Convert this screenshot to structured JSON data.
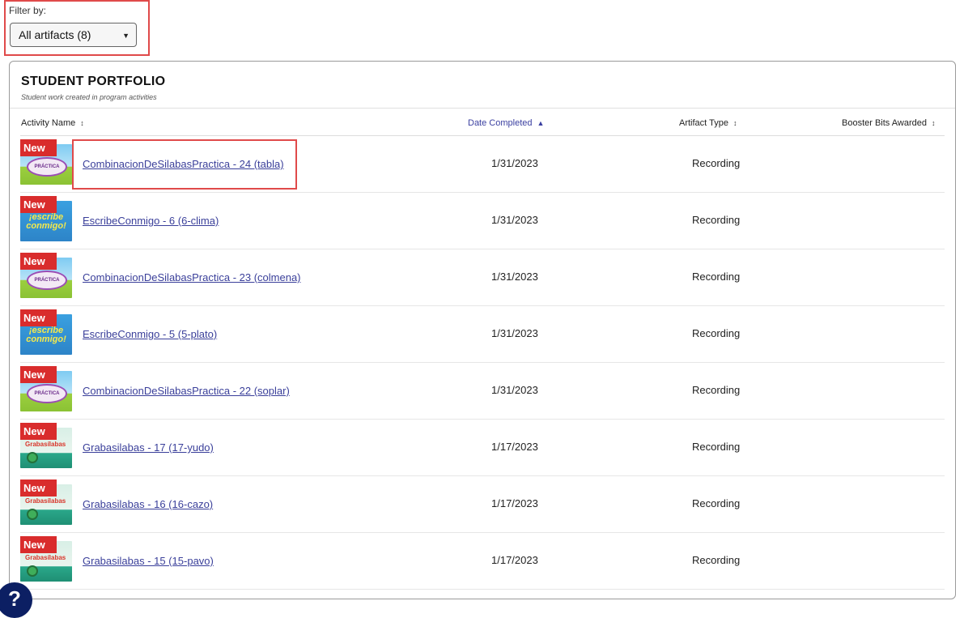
{
  "filter": {
    "label": "Filter by:",
    "selected": "All artifacts (8)",
    "caret_icon": "caret-down-icon"
  },
  "portfolio": {
    "title": "STUDENT PORTFOLIO",
    "subtitle": "Student work created in program activities"
  },
  "table": {
    "columns": [
      {
        "label": "Activity Name",
        "sort": "↕"
      },
      {
        "label": "Date Completed",
        "sort": "▲"
      },
      {
        "label": "Artifact Type",
        "sort": "↕"
      },
      {
        "label": "Booster Bits Awarded",
        "sort": "↕"
      }
    ],
    "badge_label": "New",
    "rows": [
      {
        "name": "CombinacionDeSilabasPractica - 24 (tabla)",
        "date": "1/31/2023",
        "type": "Recording",
        "bits": "",
        "thumb": "practica",
        "thumb_text": "PRÁCTICA"
      },
      {
        "name": "EscribeConmigo - 6 (6-clima)",
        "date": "1/31/2023",
        "type": "Recording",
        "bits": "",
        "thumb": "escribe",
        "thumb_text": "¡escribe conmigo!"
      },
      {
        "name": "CombinacionDeSilabasPractica - 23 (colmena)",
        "date": "1/31/2023",
        "type": "Recording",
        "bits": "",
        "thumb": "practica",
        "thumb_text": "PRÁCTICA"
      },
      {
        "name": "EscribeConmigo - 5 (5-plato)",
        "date": "1/31/2023",
        "type": "Recording",
        "bits": "",
        "thumb": "escribe",
        "thumb_text": "¡escribe conmigo!"
      },
      {
        "name": "CombinacionDeSilabasPractica - 22 (soplar)",
        "date": "1/31/2023",
        "type": "Recording",
        "bits": "",
        "thumb": "practica",
        "thumb_text": "PRÁCTICA"
      },
      {
        "name": "Grabasilabas - 17 (17-yudo)",
        "date": "1/17/2023",
        "type": "Recording",
        "bits": "",
        "thumb": "graba",
        "thumb_text": "Grabasílabas"
      },
      {
        "name": "Grabasilabas - 16 (16-cazo)",
        "date": "1/17/2023",
        "type": "Recording",
        "bits": "",
        "thumb": "graba",
        "thumb_text": "Grabasílabas"
      },
      {
        "name": "Grabasilabas - 15 (15-pavo)",
        "date": "1/17/2023",
        "type": "Recording",
        "bits": "",
        "thumb": "graba",
        "thumb_text": "Grabasílabas"
      }
    ]
  },
  "help": {
    "label": "?"
  },
  "colors": {
    "highlight": "#e04a4a",
    "badge": "#d92c2c",
    "link": "#3a3f9a",
    "help_circle": "#0c1f63"
  }
}
